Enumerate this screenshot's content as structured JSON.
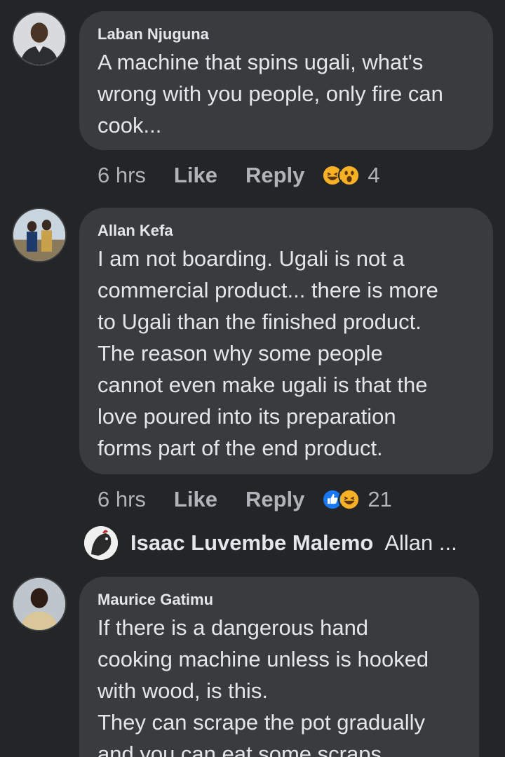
{
  "comments": [
    {
      "author": "Laban Njuguna",
      "lines": [
        "A machine that spins ugali, what's",
        "wrong with you people, only fire can",
        "cook..."
      ],
      "time": "6 hrs",
      "like_label": "Like",
      "reply_label": "Reply",
      "reactions": [
        "haha",
        "wow"
      ],
      "reaction_count": "4"
    },
    {
      "author": "Allan Kefa",
      "lines": [
        "I am not boarding. Ugali is not a",
        "commercial product... there is more",
        "to Ugali than the finished product.",
        "The reason why some people",
        "cannot even make ugali is that the",
        "love poured into its preparation",
        "forms part of the end product."
      ],
      "time": "6 hrs",
      "like_label": "Like",
      "reply_label": "Reply",
      "reactions": [
        "like",
        "haha"
      ],
      "reaction_count": "21"
    },
    {
      "author": "Maurice Gatimu",
      "lines": [
        "If there is a dangerous hand",
        "cooking machine unless is hooked",
        "with wood, is this.",
        "They can scrape the pot gradually",
        "and you can eat some scraps"
      ]
    }
  ],
  "reply_preview": {
    "author": "Isaac Luvembe Malemo",
    "snippet": "Allan ..."
  },
  "colors": {
    "background": "#242526",
    "bubble": "#3a3b3c",
    "text": "#e4e6eb",
    "muted": "#b0b3b8",
    "like_blue": "#1877f2",
    "emoji_yellow": "#f7b125"
  }
}
